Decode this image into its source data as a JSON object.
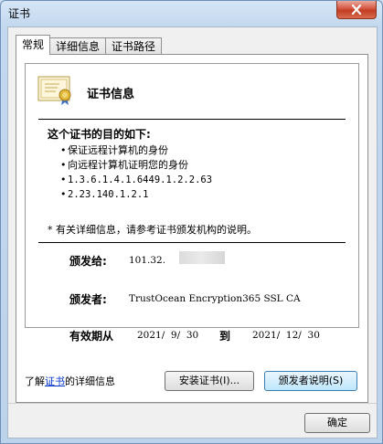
{
  "window": {
    "title": "证书"
  },
  "tabs": [
    {
      "label": "常规"
    },
    {
      "label": "详细信息"
    },
    {
      "label": "证书路径"
    }
  ],
  "certificate": {
    "title": "证书信息",
    "purpose_heading": "这个证书的目的如下:",
    "purposes": [
      "保证远程计算机的身份",
      "向远程计算机证明您的身份",
      "1.3.6.1.4.1.6449.1.2.2.63",
      "2.23.140.1.2.1"
    ],
    "note": "* 有关详细信息，请参考证书颁发机构的说明。",
    "issued_to_label": "颁发给:",
    "issued_to_value": "101.32.",
    "issued_by_label": "颁发者:",
    "issued_by_value": "TrustOcean Encryption365 SSL CA",
    "validity_label": "有效期从",
    "valid_from": "2021/  9/  30",
    "validity_to": "到",
    "valid_to": "2021/  12/  30"
  },
  "buttons": {
    "install": "安装证书(I)...",
    "issuer_statement": "颁发者说明(S)",
    "ok": "确定"
  },
  "footer": {
    "link_prefix": "了解",
    "link_text": "证书",
    "link_suffix": "的详细信息"
  },
  "icons": {
    "close": "close-icon",
    "certificate": "certificate-icon"
  },
  "colors": {
    "close_button": "#c23b23",
    "link": "#0033cc",
    "title_bar": "#c3d8ef"
  }
}
